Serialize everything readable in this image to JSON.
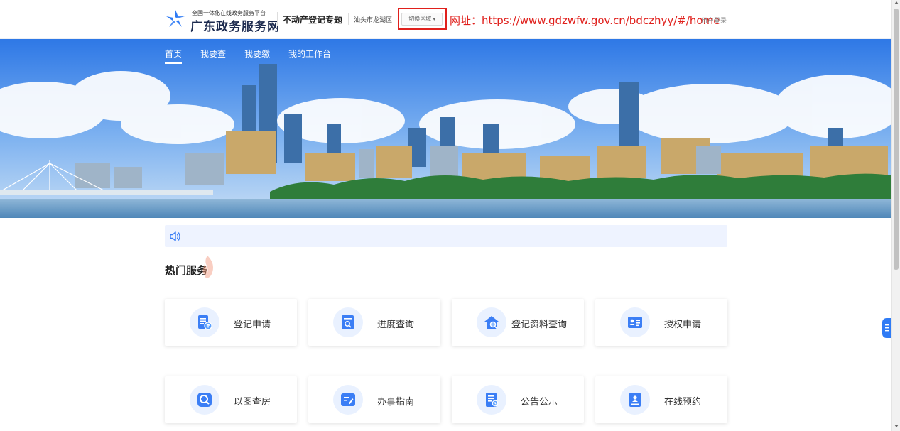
{
  "header": {
    "platform_small": "全国一体化在线政务服务平台",
    "platform_name": "广东政务服务网",
    "topic": "不动产登记专题",
    "region": "汕头市龙湖区",
    "switch_region": "切换区域",
    "url_note": "网址：https://www.gdzwfw.gov.cn/bdczhyy/#/home",
    "login": "用户登录"
  },
  "nav": {
    "items": [
      "首页",
      "我要查",
      "我要缴",
      "我的工作台"
    ],
    "active": "首页"
  },
  "hot_services": {
    "title": "热门服务",
    "cards": [
      {
        "label": "登记申请",
        "icon": "file-upload-icon"
      },
      {
        "label": "进度查询",
        "icon": "document-search-icon"
      },
      {
        "label": "登记资料查询",
        "icon": "house-search-icon"
      },
      {
        "label": "授权申请",
        "icon": "id-card-icon"
      },
      {
        "label": "以图查房",
        "icon": "map-search-icon"
      },
      {
        "label": "办事指南",
        "icon": "guide-edit-icon"
      },
      {
        "label": "公告公示",
        "icon": "notice-document-icon"
      },
      {
        "label": "在线预约",
        "icon": "appointment-icon"
      }
    ]
  },
  "colors": {
    "accent": "#2f7bf5",
    "highlight_red": "#e0201c",
    "notice_bg": "#eef3ff",
    "icon_bg": "#e9f1ff"
  }
}
